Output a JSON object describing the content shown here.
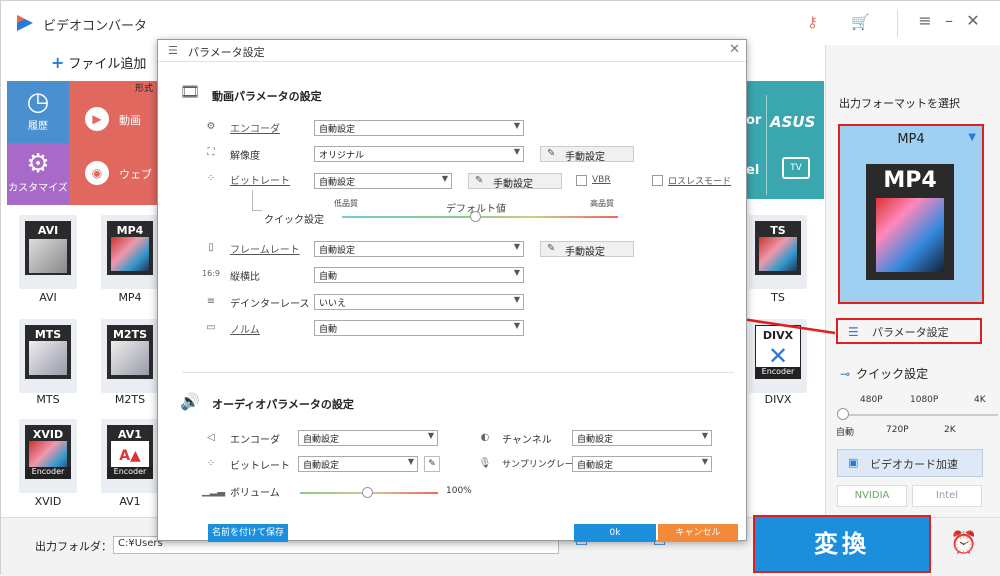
{
  "app": {
    "title": "ビデオコンバータ"
  },
  "toolbar": {
    "add_file_label": "ファイル追加"
  },
  "categories": [
    {
      "label": "履歴"
    },
    {
      "label": "カスタマイズ"
    }
  ],
  "category_rows": [
    {
      "label": "動画"
    },
    {
      "label": "ウェブ"
    }
  ],
  "partial_texts": {
    "tab_prefix": "形式",
    "brand_asus": "ASUS",
    "brand_dell": "el",
    "brand_or": "or",
    "tv_label": "TV"
  },
  "formats": [
    {
      "label": "AVI",
      "tile": "AVI"
    },
    {
      "label": "MP4",
      "tile": "MP4"
    },
    {
      "label": "MTS",
      "tile": "MTS"
    },
    {
      "label": "M2TS",
      "tile": "M2TS"
    },
    {
      "label": "XVID",
      "tile": "XVID"
    },
    {
      "label": "AV1",
      "tile": "AV1"
    },
    {
      "label": "TS",
      "tile": "TS"
    },
    {
      "label": "DIVX",
      "tile": "DIVX"
    }
  ],
  "encoder_badge": "Encoder",
  "bottom": {
    "output_folder_label": "出力フォルダ：",
    "output_path": "C:¥Users",
    "convert_label": "変換"
  },
  "right_panel": {
    "title": "出力フォーマットを選択",
    "selected_format": "MP4",
    "param_button": "パラメータ設定",
    "quick_setting": "クイック設定",
    "resolution_top": [
      "480P",
      "1080P",
      "4K"
    ],
    "resolution_bottom": [
      "自動",
      "720P",
      "2K"
    ],
    "resolution_value": "自動",
    "gpu_accel": "ビデオカード加速",
    "vendors": [
      "NVIDIA",
      "Intel"
    ]
  },
  "dialog": {
    "title": "パラメータ設定",
    "video_section": "動画パラメータの設定",
    "video_rows": [
      {
        "label": "エンコーダ",
        "value": "自動設定"
      },
      {
        "label": "解像度",
        "value": "オリジナル"
      },
      {
        "label": "ビットレート",
        "value": "自動設定"
      },
      {
        "label": "フレームレート",
        "value": "自動設定"
      },
      {
        "label": "縦横比",
        "value": "自動"
      },
      {
        "label": "デインターレース",
        "value": "いいえ"
      },
      {
        "label": "ノルム",
        "value": "自動"
      }
    ],
    "manual_button": "手動設定",
    "vbr_label": "VBR",
    "lossless_label": "ロスレスモード",
    "quick_label": "クイック設定",
    "quality_low": "低品質",
    "quality_default": "デフォルト値",
    "quality_high": "高品質",
    "audio_section": "オーディオパラメータの設定",
    "audio_rows": [
      {
        "label": "エンコーダ",
        "value": "自動設定"
      },
      {
        "label": "ビットレート",
        "value": "自動設定"
      },
      {
        "label": "チャンネル",
        "value": "自動設定"
      },
      {
        "label": "サンプリングレート",
        "value": "自動設定"
      }
    ],
    "volume_label": "ボリューム",
    "volume_value": "100%",
    "save_as_label": "名前を付けて保存",
    "ok_label": "0k",
    "cancel_label": "キャンセル"
  },
  "colors": {
    "accent": "#1c8fdc",
    "highlight_border": "#e02020",
    "category_blue": "#4a8fd0",
    "category_purple": "#a86ac8",
    "category_red": "#e0685f",
    "teal": "#3aa6ae",
    "cancel_orange": "#f28a3a"
  }
}
